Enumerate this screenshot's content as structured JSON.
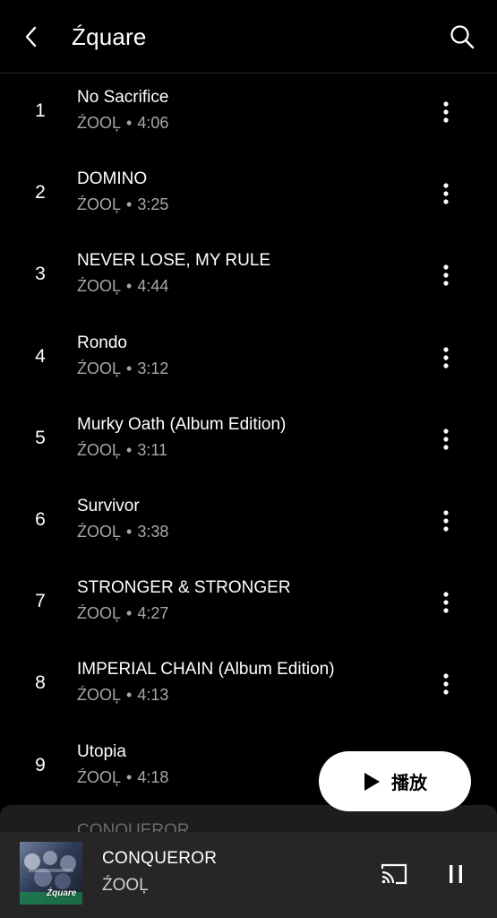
{
  "header": {
    "title": "Źquare",
    "back_icon": "chevron-left-icon",
    "search_icon": "search-icon"
  },
  "tracks": [
    {
      "num": "1",
      "title": "No Sacrifice",
      "artist": "ŹOOĻ",
      "sep": "•",
      "duration": "4:06"
    },
    {
      "num": "2",
      "title": "DOMINO",
      "artist": "ŹOOĻ",
      "sep": "•",
      "duration": "3:25"
    },
    {
      "num": "3",
      "title": "NEVER LOSE, MY RULE",
      "artist": "ŹOOĻ",
      "sep": "•",
      "duration": "4:44"
    },
    {
      "num": "4",
      "title": "Rondo",
      "artist": "ŹOOĻ",
      "sep": "•",
      "duration": "3:12"
    },
    {
      "num": "5",
      "title": "Murky Oath (Album Edition)",
      "artist": "ŹOOĻ",
      "sep": "•",
      "duration": "3:11"
    },
    {
      "num": "6",
      "title": "Survivor",
      "artist": "ŹOOĻ",
      "sep": "•",
      "duration": "3:38"
    },
    {
      "num": "7",
      "title": "STRONGER & STRONGER",
      "artist": "ŹOOĻ",
      "sep": "•",
      "duration": "4:27"
    },
    {
      "num": "8",
      "title": "IMPERIAL CHAIN (Album Edition)",
      "artist": "ŹOOĻ",
      "sep": "•",
      "duration": "4:13"
    },
    {
      "num": "9",
      "title": "Utopia",
      "artist": "ŹOOĻ",
      "sep": "•",
      "duration": "4:18"
    }
  ],
  "play_button": {
    "label": "播放",
    "icon": "play-icon"
  },
  "sheet_peek_title": "CONQUEROR",
  "now_playing": {
    "title": "CONQUEROR",
    "artist": "ŹOOĻ",
    "cover_text": "Źquare",
    "cast_icon": "cast-icon",
    "pause_icon": "pause-icon"
  },
  "colors": {
    "background": "#000000",
    "secondary_text": "#a8a8a8",
    "mini_player_bg": "#262626",
    "play_button_bg": "#ffffff"
  }
}
